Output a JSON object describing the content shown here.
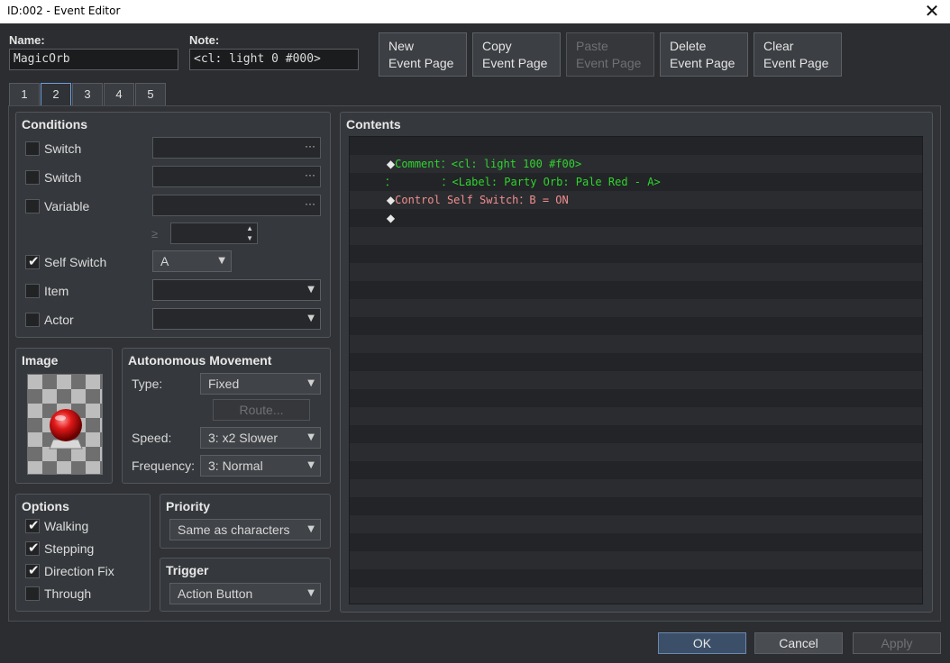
{
  "window": {
    "title": "ID:002 - Event Editor",
    "close_icon": "close-icon"
  },
  "header": {
    "name_label": "Name:",
    "name_value": "MagicOrb",
    "note_label": "Note:",
    "note_value": "<cl: light 0 #000>",
    "buttons": [
      {
        "line1": "New",
        "line2": "Event Page",
        "enabled": true
      },
      {
        "line1": "Copy",
        "line2": "Event Page",
        "enabled": true
      },
      {
        "line1": "Paste",
        "line2": "Event Page",
        "enabled": false
      },
      {
        "line1": "Delete",
        "line2": "Event Page",
        "enabled": true
      },
      {
        "line1": "Clear",
        "line2": "Event Page",
        "enabled": true
      }
    ]
  },
  "tabs": [
    "1",
    "2",
    "3",
    "4",
    "5"
  ],
  "active_tab": "2",
  "conditions": {
    "title": "Conditions",
    "switch1": {
      "label": "Switch",
      "checked": false
    },
    "switch2": {
      "label": "Switch",
      "checked": false
    },
    "variable": {
      "label": "Variable",
      "checked": false,
      "op": "≥"
    },
    "self_switch": {
      "label": "Self Switch",
      "checked": true,
      "value": "A"
    },
    "item": {
      "label": "Item",
      "checked": false
    },
    "actor": {
      "label": "Actor",
      "checked": false
    }
  },
  "image": {
    "title": "Image",
    "sprite": "red-orb"
  },
  "movement": {
    "title": "Autonomous Movement",
    "type_label": "Type:",
    "type_value": "Fixed",
    "route_label": "Route...",
    "speed_label": "Speed:",
    "speed_value": "3: x2 Slower",
    "frequency_label": "Frequency:",
    "frequency_value": "3: Normal"
  },
  "options": {
    "title": "Options",
    "walking": {
      "label": "Walking",
      "checked": true
    },
    "stepping": {
      "label": "Stepping",
      "checked": true
    },
    "direction_fix": {
      "label": "Direction Fix",
      "checked": true
    },
    "through": {
      "label": "Through",
      "checked": false
    }
  },
  "priority": {
    "title": "Priority",
    "value": "Same as characters"
  },
  "trigger": {
    "title": "Trigger",
    "value": "Action Button"
  },
  "contents": {
    "title": "Contents",
    "lines": [
      {
        "prefix": "◆",
        "text": "Comment：<cl: light 100 #f00>",
        "color": "#2ed52e"
      },
      {
        "prefix": "：",
        "text": "       ：<Label: Party Orb: Pale Red - A>",
        "color": "#2ed52e"
      },
      {
        "prefix": "◆",
        "text": "Control Self Switch：B = ON",
        "color": "#f08f8f"
      },
      {
        "prefix": "◆",
        "text": "",
        "color": "#e8e8e8"
      }
    ]
  },
  "footer": {
    "ok": "OK",
    "cancel": "Cancel",
    "apply": "Apply"
  }
}
